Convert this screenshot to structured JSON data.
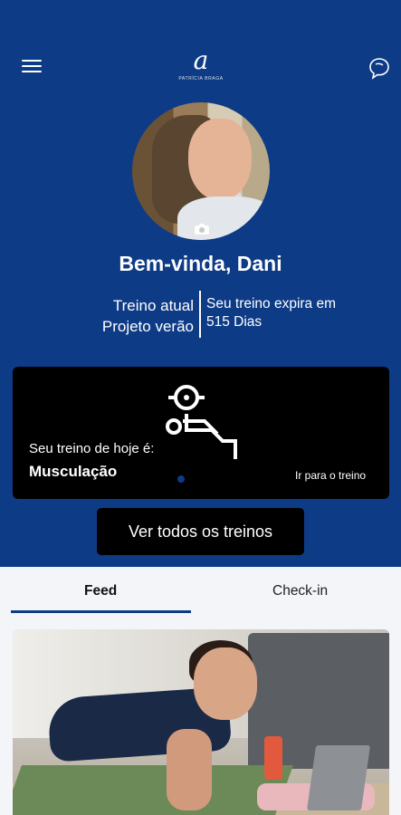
{
  "header": {
    "logo_mark": "a",
    "logo_subtitle": "PATRÍCIA BRAGA",
    "menu_icon": "hamburger-menu-icon",
    "chat_icon": "chat-bubble-icon"
  },
  "profile": {
    "welcome": "Bem-vinda, Dani",
    "camera_icon": "camera-icon"
  },
  "training_info": {
    "current_label": "Treino atual",
    "current_value": "Projeto verão",
    "expires_label": "Seu treino expira em",
    "expires_value": "515 Dias"
  },
  "today_card": {
    "icon": "bench-press-icon",
    "label": "Seu treino de hoje é:",
    "title": "Musculação",
    "link": "Ir para o treino"
  },
  "actions": {
    "all_trainings": "Ver todos os treinos"
  },
  "tabs": [
    {
      "label": "Feed",
      "active": true
    },
    {
      "label": "Check-in",
      "active": false
    }
  ],
  "colors": {
    "primary": "#0d3b86",
    "card": "#000000",
    "background": "#f4f5f9"
  }
}
